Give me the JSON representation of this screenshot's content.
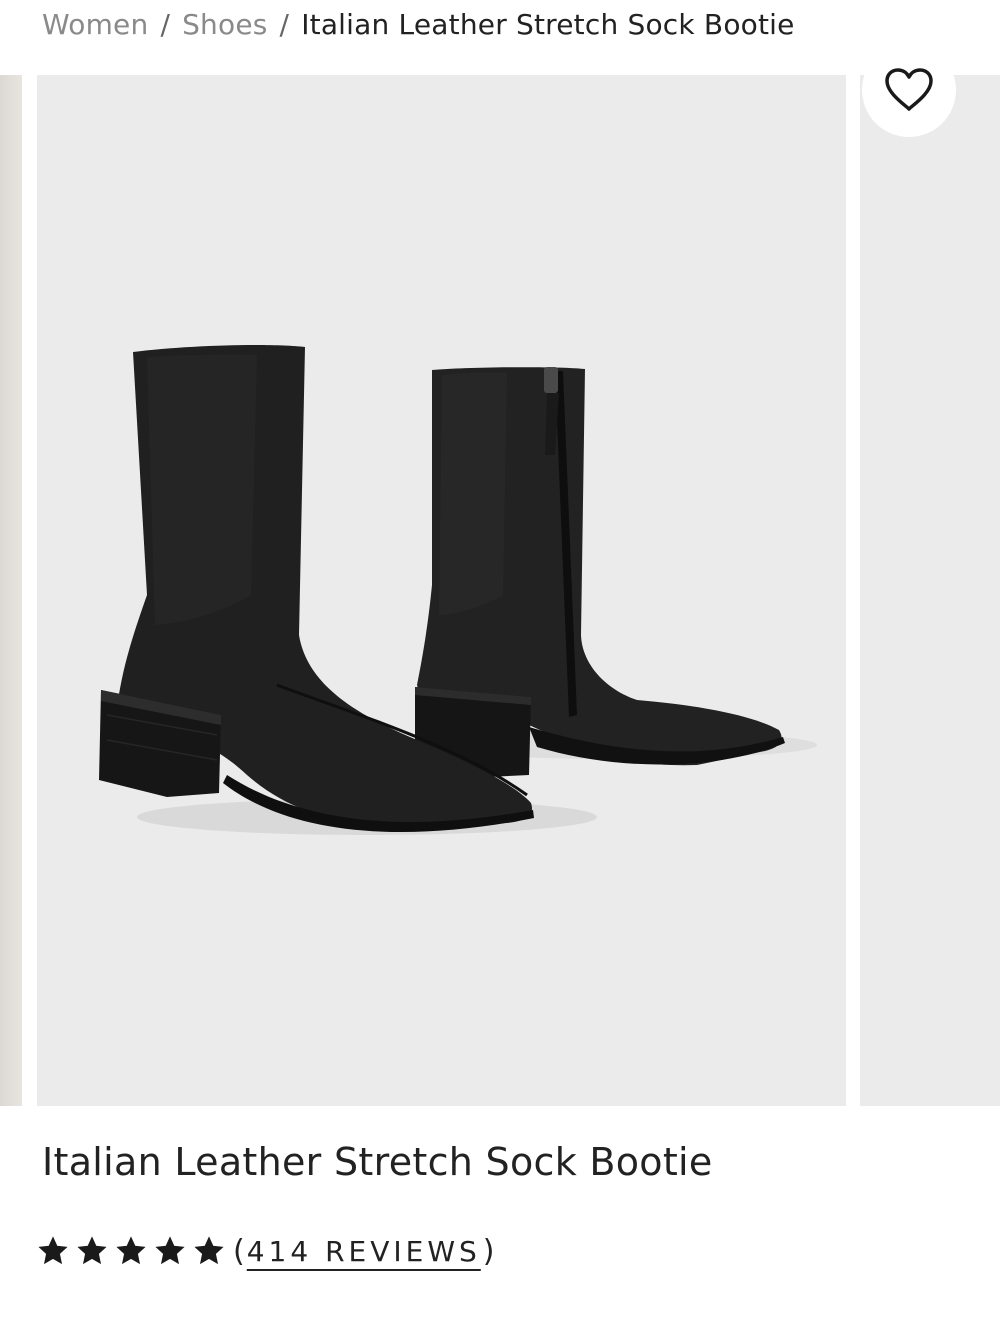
{
  "breadcrumb": {
    "items": [
      "Women",
      "Shoes"
    ],
    "separator": "/",
    "current": "Italian Leather Stretch Sock Bootie"
  },
  "gallery": {
    "image_alt": "Italian Leather Stretch Sock Bootie",
    "wishlist_icon": "heart-icon"
  },
  "product": {
    "title": "Italian Leather Stretch Sock Bootie",
    "rating": 5,
    "rating_max": 5,
    "review_count_label": "414 REVIEWS",
    "paren_open": "(",
    "paren_close": ")"
  },
  "colors": {
    "image_bg": "#ebebeb",
    "text": "#222222",
    "muted": "#8a8a8a",
    "boot": "#1e1e1e"
  }
}
